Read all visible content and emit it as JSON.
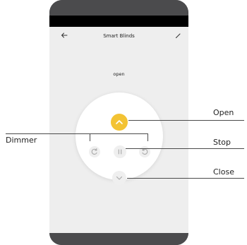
{
  "header": {
    "title": "Smart Blinds",
    "back_icon": "arrow-left-icon",
    "edit_icon": "pencil-icon"
  },
  "status": {
    "text": "open"
  },
  "remote": {
    "open_icon": "chevron-up-icon",
    "stop_icon": "pause-icon",
    "close_icon": "chevron-down-icon",
    "dimmer_left_icon": "rotate-right-icon",
    "dimmer_right_icon": "rotate-left-icon",
    "accent_color": "#f3c334"
  },
  "callouts": {
    "open": "Open",
    "stop": "Stop",
    "close": "Close",
    "dimmer": "Dimmer"
  }
}
